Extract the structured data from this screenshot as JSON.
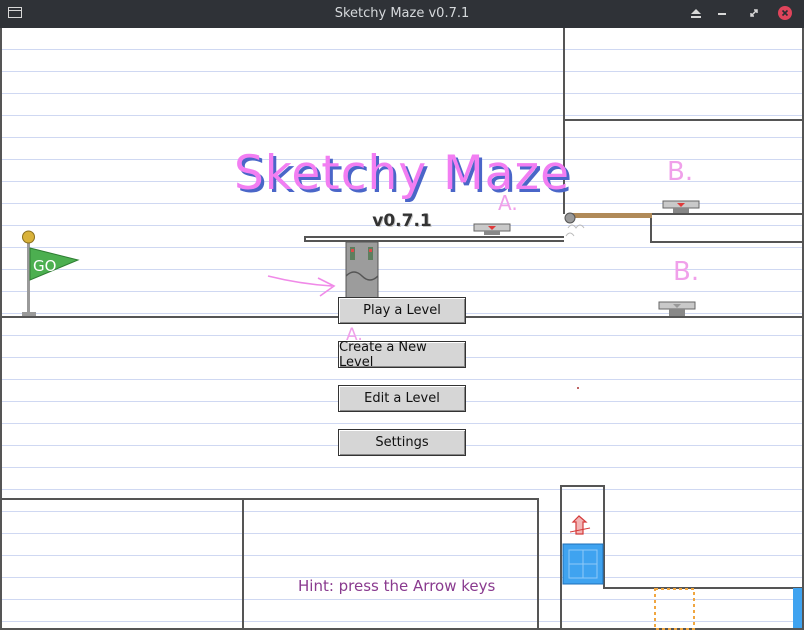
{
  "window": {
    "title": "Sketchy Maze v0.7.1",
    "controls": [
      "eject-icon",
      "minimize-icon",
      "restore-icon",
      "close-icon"
    ]
  },
  "game": {
    "title": "Sketchy Maze",
    "version": "v0.7.1",
    "flag_label": "GO",
    "doodles": {
      "label_a": "A.",
      "label_b": "B."
    },
    "hint": "Hint: press the Arrow keys"
  },
  "menu": {
    "play": "Play a Level",
    "create": "Create a New Level",
    "edit": "Edit a Level",
    "settings": "Settings"
  },
  "colors": {
    "title_fill": "#f27ef2",
    "title_shadow": "#4a66c8",
    "ruled_line": "#cfd8f2",
    "hint_text": "#8a3b8f",
    "flag_green": "#4caf50",
    "close_button": "#e0445b",
    "blue_block": "#3fa3f0"
  }
}
